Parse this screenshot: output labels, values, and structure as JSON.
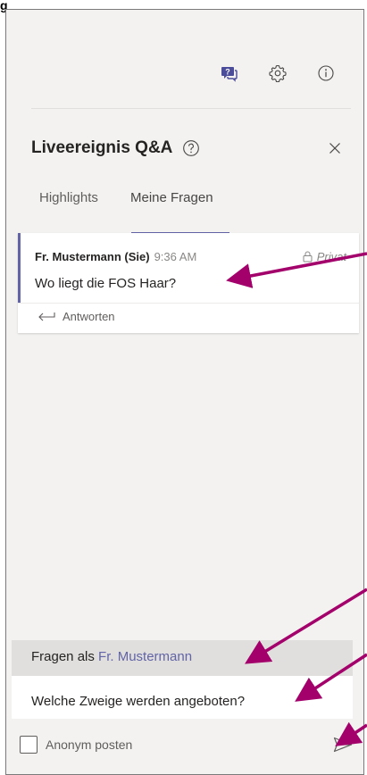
{
  "corner_label": "g",
  "toolbar": {
    "icons": [
      "qa-icon",
      "gear-icon",
      "info-icon"
    ]
  },
  "panel": {
    "title": "Liveereignis Q&A",
    "tabs": [
      {
        "label": "Highlights",
        "selected": false
      },
      {
        "label": "Meine Fragen",
        "selected": true
      }
    ]
  },
  "question_card": {
    "author": "Fr. Mustermann (Sie)",
    "time": "9:36 AM",
    "privacy": "Privat",
    "text": "Wo liegt die FOS Haar?",
    "reply_label": "Antworten"
  },
  "compose": {
    "header_prefix": "Fragen als",
    "header_name": "Fr. Mustermann",
    "input_value": "Welche Zweige werden angeboten?",
    "anonymous_label": "Anonym posten",
    "anonymous_checked": false
  },
  "colors": {
    "accent": "#6264a7",
    "annotation_arrow": "#a3006b",
    "panel_bg": "#f3f2f1"
  }
}
